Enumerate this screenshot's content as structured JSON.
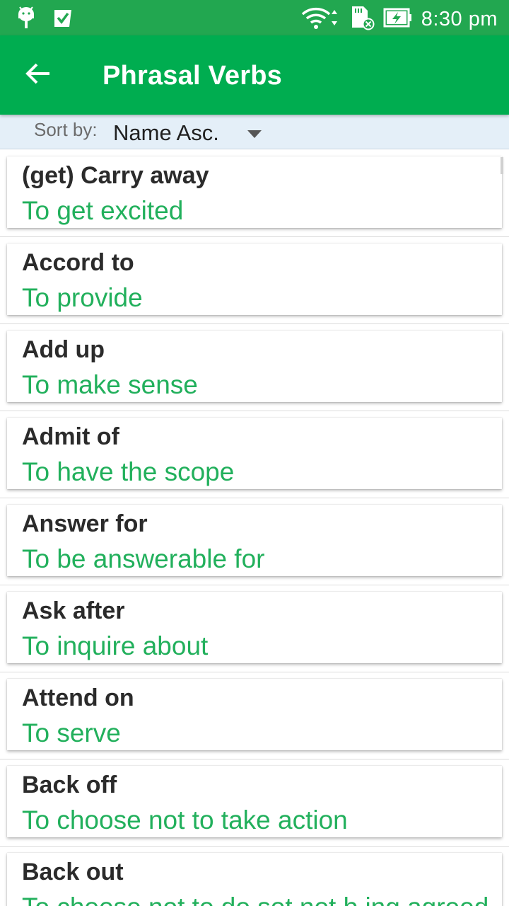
{
  "status_bar": {
    "time": "8:30 pm",
    "left_icons": [
      "android-icon",
      "check-icon"
    ],
    "right_icons": [
      "wifi-icon",
      "sd-card-icon",
      "battery-charging-icon"
    ]
  },
  "app_bar": {
    "title": "Phrasal Verbs",
    "back_icon": "arrow-left-icon",
    "color": "#00ad50"
  },
  "sort": {
    "label": "Sort by:",
    "selected": "Name Asc."
  },
  "items": [
    {
      "term": "(get) Carry away",
      "meaning": "To get excited"
    },
    {
      "term": "Accord to",
      "meaning": "To provide"
    },
    {
      "term": "Add up",
      "meaning": "To make sense"
    },
    {
      "term": "Admit of",
      "meaning": "To have the scope"
    },
    {
      "term": "Answer for",
      "meaning": "To be answerable for"
    },
    {
      "term": "Ask after",
      "meaning": "To inquire about"
    },
    {
      "term": "Attend on",
      "meaning": "To serve"
    },
    {
      "term": "Back off",
      "meaning": "To choose not to take action"
    },
    {
      "term": "Back out",
      "meaning": "To choose not to do sot not b ing agreed"
    }
  ],
  "colors": {
    "term": "#2b2b2b",
    "meaning": "#22b05c",
    "status_bar": "#22a750"
  }
}
